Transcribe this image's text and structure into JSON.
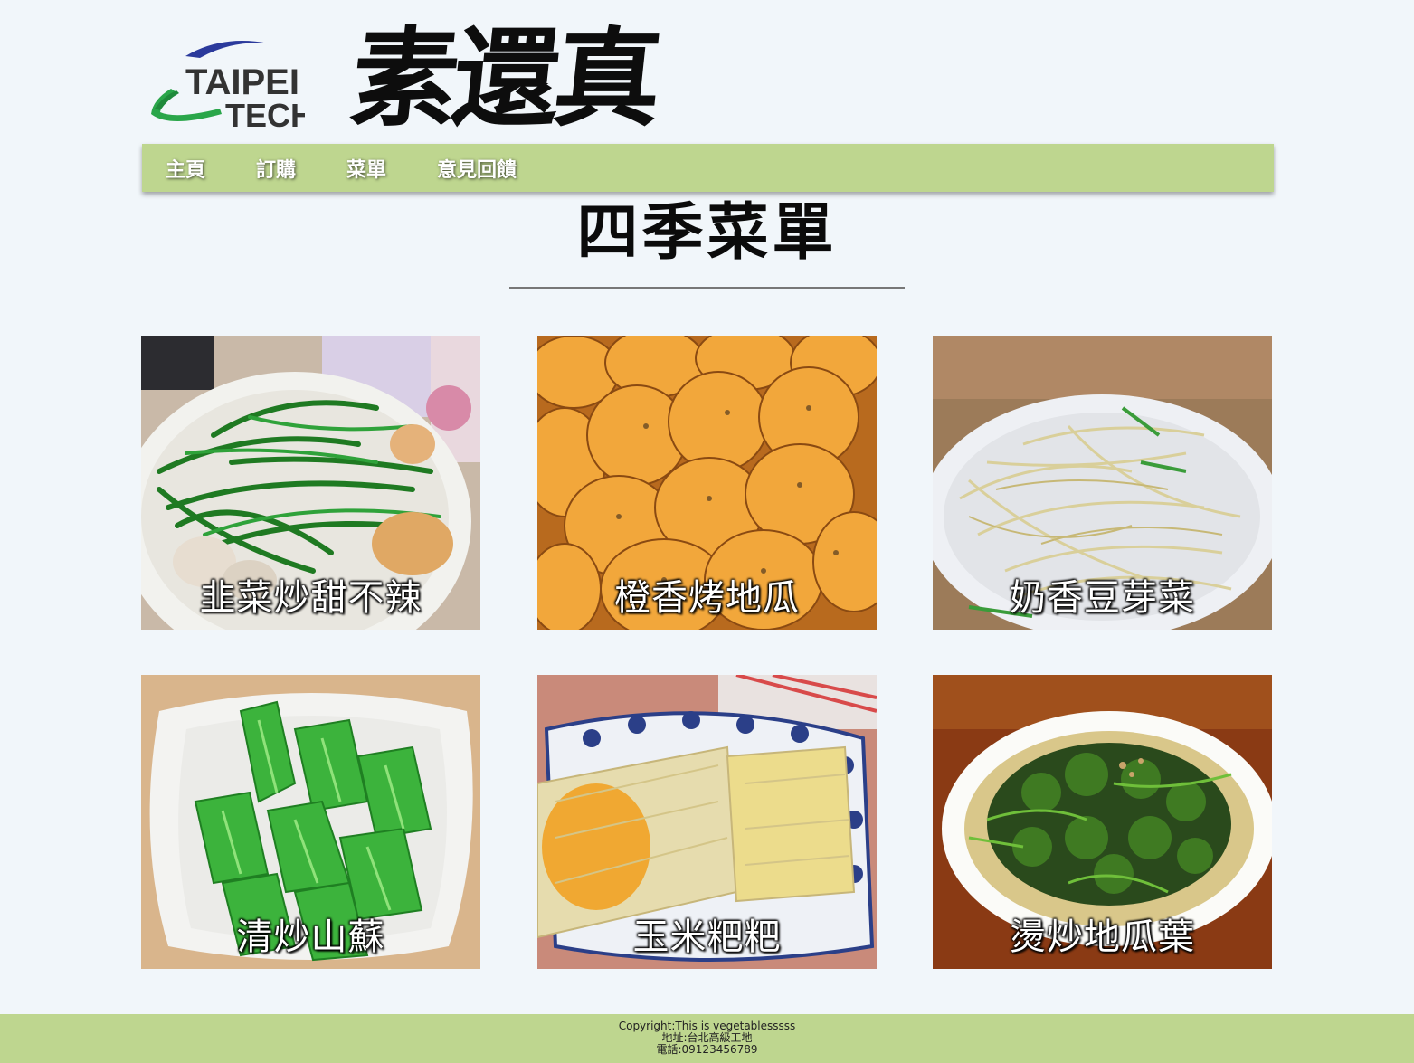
{
  "header": {
    "logo_line1": "TAIPEI",
    "logo_line2": "TECH",
    "brand_title": "素還真"
  },
  "nav": {
    "items": [
      {
        "label": "主頁"
      },
      {
        "label": "訂購"
      },
      {
        "label": "菜單"
      },
      {
        "label": "意見回饋"
      }
    ]
  },
  "main": {
    "title": "四季菜單",
    "dishes": [
      {
        "label": "韭菜炒甜不辣",
        "icon": "chive-stirfry-photo"
      },
      {
        "label": "橙香烤地瓜",
        "icon": "roasted-sweet-potato-photo"
      },
      {
        "label": "奶香豆芽菜",
        "icon": "bean-sprouts-photo"
      },
      {
        "label": "清炒山蘇",
        "icon": "bird-nest-fern-photo"
      },
      {
        "label": "玉米粑粑",
        "icon": "corn-cake-photo"
      },
      {
        "label": "燙炒地瓜葉",
        "icon": "sweet-potato-leaves-photo"
      }
    ]
  },
  "footer": {
    "copyright": "Copyright:This is vegetablesssss",
    "address": "地址:台北高級工地",
    "phone": "電話:09123456789"
  },
  "colors": {
    "background": "#f1f6fa",
    "nav_bar": "#bed68f",
    "footer_bar": "#bed68f"
  }
}
